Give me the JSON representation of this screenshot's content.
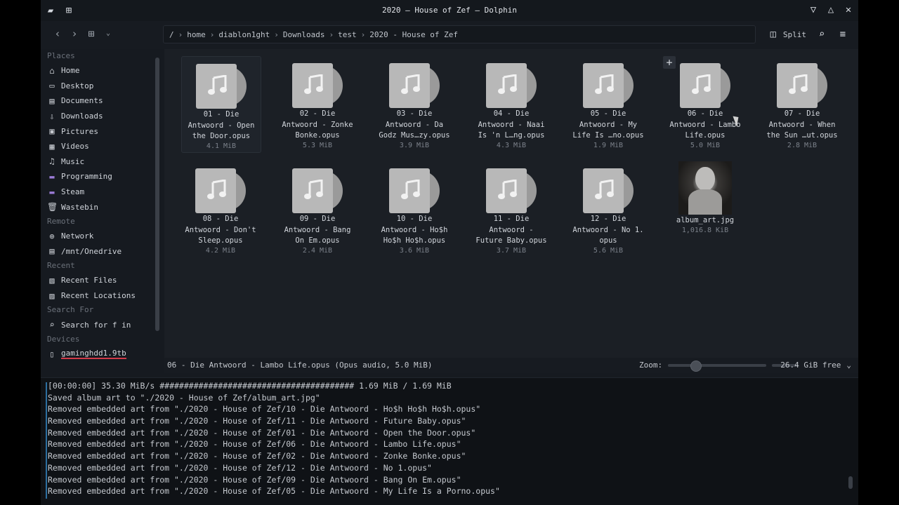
{
  "window": {
    "title": "2020 — House of Zef — Dolphin"
  },
  "icons": {
    "app_menu": "window-menu-icon",
    "grid": "grid-icon",
    "minimize": "chevron-down-icon",
    "maximize": "chevron-up-icon",
    "close": "close-icon"
  },
  "toolbar": {
    "breadcrumb": [
      "/",
      "home",
      "diablon1ght",
      "Downloads",
      "test",
      "2020 - House of Zef"
    ],
    "split_label": "Split"
  },
  "sidebar": {
    "places_header": "Places",
    "places": [
      {
        "label": "Home",
        "icon": "home-icon"
      },
      {
        "label": "Desktop",
        "icon": "desktop-icon"
      },
      {
        "label": "Documents",
        "icon": "documents-icon"
      },
      {
        "label": "Downloads",
        "icon": "downloads-icon"
      },
      {
        "label": "Pictures",
        "icon": "pictures-icon"
      },
      {
        "label": "Videos",
        "icon": "videos-icon"
      },
      {
        "label": "Music",
        "icon": "music-icon"
      },
      {
        "label": "Programming",
        "icon": "folder-icon"
      },
      {
        "label": "Steam",
        "icon": "folder-icon"
      },
      {
        "label": "Wastebin",
        "icon": "trash-icon"
      }
    ],
    "remote_header": "Remote",
    "remote": [
      {
        "label": "Network",
        "icon": "network-icon"
      },
      {
        "label": "/mnt/Onedrive",
        "icon": "drive-icon"
      }
    ],
    "recent_header": "Recent",
    "recent": [
      {
        "label": "Recent Files",
        "icon": "recent-files-icon"
      },
      {
        "label": "Recent Locations",
        "icon": "recent-locations-icon"
      }
    ],
    "search_header": "Search For",
    "search": [
      {
        "label": "Search for f in",
        "icon": "search-icon"
      }
    ],
    "devices_header": "Devices",
    "devices": [
      {
        "label": "gaminghdd1.9tb",
        "icon": "device-icon"
      }
    ]
  },
  "files": [
    {
      "name": "01 - Die Antwoord - Open the Door.opus",
      "line1": "01 - Die",
      "line2": "Antwoord - Open",
      "line3": "the Door.opus",
      "size": "4.1 MiB"
    },
    {
      "name": "02 - Die Antwoord - Zonke Bonke.opus",
      "line1": "02 - Die",
      "line2": "Antwoord - Zonke",
      "line3": "Bonke.opus",
      "size": "5.3 MiB"
    },
    {
      "name": "03",
      "line1": "03 - Die",
      "line2": "Antwoord - Da",
      "line3": "Godz Mus…zy.opus",
      "size": "3.9 MiB"
    },
    {
      "name": "04",
      "line1": "04 - Die",
      "line2": "Antwoord - Naai",
      "line3": "Is 'n L…ng.opus",
      "size": "4.3 MiB"
    },
    {
      "name": "05",
      "line1": "05 - Die",
      "line2": "Antwoord - My",
      "line3": "Life Is …no.opus",
      "size": "1.9 MiB"
    },
    {
      "name": "06",
      "line1": "06 - Die",
      "line2": "Antwoord - Lambo",
      "line3": "Life.opus",
      "size": "5.0 MiB"
    },
    {
      "name": "07",
      "line1": "07 - Die",
      "line2": "Antwoord - When",
      "line3": "the Sun …ut.opus",
      "size": "2.8 MiB"
    },
    {
      "name": "08",
      "line1": "08 - Die",
      "line2": "Antwoord - Don't",
      "line3": "Sleep.opus",
      "size": "4.2 MiB"
    },
    {
      "name": "09",
      "line1": "09 - Die",
      "line2": "Antwoord - Bang",
      "line3": "On Em.opus",
      "size": "2.4 MiB"
    },
    {
      "name": "10",
      "line1": "10 - Die",
      "line2": "Antwoord - Ho$h",
      "line3": "Ho$h Ho$h.opus",
      "size": "3.6 MiB"
    },
    {
      "name": "11",
      "line1": "11 - Die",
      "line2": "Antwoord -",
      "line3": "Future Baby.opus",
      "size": "3.7 MiB"
    },
    {
      "name": "12",
      "line1": "12 - Die",
      "line2": "Antwoord - No 1.",
      "line3": "opus",
      "size": "5.6 MiB"
    },
    {
      "name": "album_art.jpg",
      "line1": "album_art.jpg",
      "line2": "",
      "line3": "",
      "size": "1,016.8 KiB"
    }
  ],
  "status": {
    "selection": "06 - Die Antwoord - Lambo Life.opus (Opus audio, 5.0 MiB)",
    "zoom_label": "Zoom:",
    "free_space": "26.4 GiB free"
  },
  "terminal": {
    "lines": [
      "[00:00:00] 35.30 MiB/s ######################################## 1.69 MiB / 1.69 MiB",
      "Saved album art to \"./2020 - House of Zef/album_art.jpg\"",
      "Removed embedded art from \"./2020 - House of Zef/10 - Die Antwoord - Ho$h Ho$h Ho$h.opus\"",
      "Removed embedded art from \"./2020 - House of Zef/11 - Die Antwoord - Future Baby.opus\"",
      "Removed embedded art from \"./2020 - House of Zef/01 - Die Antwoord - Open the Door.opus\"",
      "Removed embedded art from \"./2020 - House of Zef/06 - Die Antwoord - Lambo Life.opus\"",
      "Removed embedded art from \"./2020 - House of Zef/02 - Die Antwoord - Zonke Bonke.opus\"",
      "Removed embedded art from \"./2020 - House of Zef/12 - Die Antwoord - No 1.opus\"",
      "Removed embedded art from \"./2020 - House of Zef/09 - Die Antwoord - Bang On Em.opus\"",
      "Removed embedded art from \"./2020 - House of Zef/05 - Die Antwoord - My Life Is a Porno.opus\""
    ]
  },
  "colors": {
    "accent": "#2d6fa0",
    "device_underline": "#d13b4a"
  }
}
